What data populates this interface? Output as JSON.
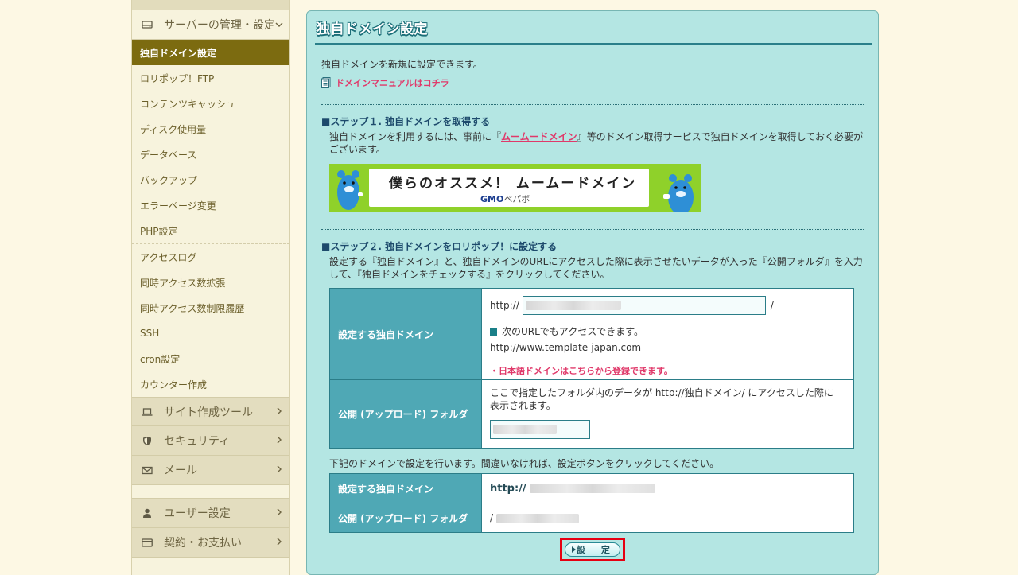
{
  "sidebar": {
    "server": {
      "label": "サーバーの管理・設定",
      "items": [
        {
          "label": "独自ドメイン設定"
        },
        {
          "label": "ロリポップ！FTP"
        },
        {
          "label": "コンテンツキャッシュ"
        },
        {
          "label": "ディスク使用量"
        },
        {
          "label": "データベース"
        },
        {
          "label": "バックアップ"
        },
        {
          "label": "エラーページ変更"
        },
        {
          "label": "PHP設定"
        },
        {
          "label": "アクセスログ"
        },
        {
          "label": "同時アクセス数拡張"
        },
        {
          "label": "同時アクセス数制限履歴"
        },
        {
          "label": "SSH"
        },
        {
          "label": "cron設定"
        },
        {
          "label": "カウンター作成"
        }
      ]
    },
    "site_tools": "サイト作成ツール",
    "security": "セキュリティ",
    "mail": "メール",
    "user_settings": "ユーザー設定",
    "billing": "契約・お支払い"
  },
  "main": {
    "title": "独自ドメイン設定",
    "intro": "独自ドメインを新規に設定できます。",
    "manual_link": "ドメインマニュアルはコチラ",
    "step1": {
      "title": "■ステップ１. 独自ドメインを取得する",
      "text_before": "独自ドメインを利用するには、事前に『",
      "link": "ムームードメイン",
      "text_after": "』等のドメイン取得サービスで独自ドメインを取得しておく必要がございます。"
    },
    "banner": {
      "message": "僕らのオススメ！ ムームードメイン",
      "brand": "GMO",
      "brand_sub": "ペパボ"
    },
    "step2": {
      "title": "■ステップ２. 独自ドメインをロリポップ！に設定する",
      "text": "設定する『独自ドメイン』と、独自ドメインのURLにアクセスした際に表示させたいデータが入った『公開フォルダ』を入力して、『独自ドメインをチェックする』をクリックしてください。"
    },
    "form": {
      "domain_label": "設定する独自ドメイン",
      "http_prefix": "http://",
      "slash": "/",
      "note": "次のURLでもアクセスできます。",
      "alt_url": "http://www.template-japan.com",
      "jp_link": "・日本語ドメインはこちらから登録できます。",
      "folder_label": "公開 (アップロード) フォルダ",
      "folder_desc": "ここで指定したフォルダ内のデータが http://独自ドメイン/ にアクセスした際に表示されます。"
    },
    "confirm": {
      "text": "下記のドメインで設定を行います。間違いなければ、設定ボタンをクリックしてください。",
      "domain_label": "設定する独自ドメイン",
      "domain_prefix": "http://",
      "folder_label": "公開 (アップロード) フォルダ",
      "folder_prefix": "/"
    },
    "submit_label": "設 定"
  }
}
